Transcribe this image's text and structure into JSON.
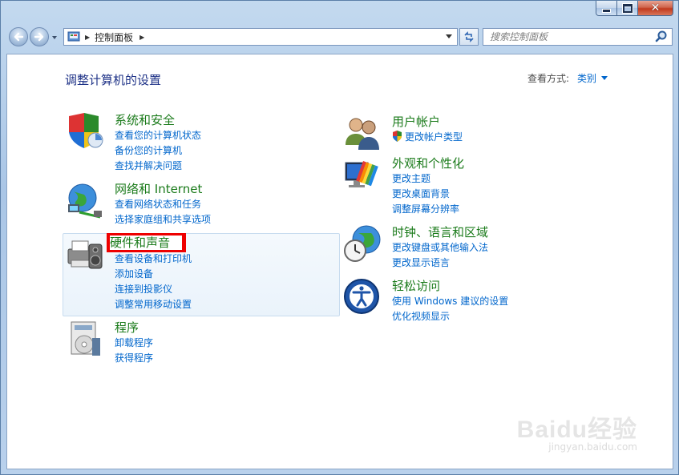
{
  "window": {
    "controls": {
      "minimize": "—",
      "maximize": "□",
      "close": "✕"
    }
  },
  "nav": {
    "breadcrumb": "控制面板",
    "search_placeholder": "搜索控制面板"
  },
  "main": {
    "title": "调整计算机的设置",
    "view_by_label": "查看方式:",
    "view_by_value": "类别"
  },
  "categories": {
    "system_security": {
      "title": "系统和安全",
      "links": [
        "查看您的计算机状态",
        "备份您的计算机",
        "查找并解决问题"
      ]
    },
    "network": {
      "title": "网络和 Internet",
      "links": [
        "查看网络状态和任务",
        "选择家庭组和共享选项"
      ]
    },
    "hardware_sound": {
      "title": "硬件和声音",
      "links": [
        "查看设备和打印机",
        "添加设备",
        "连接到投影仪",
        "调整常用移动设置"
      ]
    },
    "programs": {
      "title": "程序",
      "links": [
        "卸载程序",
        "获得程序"
      ]
    },
    "user_accounts": {
      "title": "用户帐户",
      "links": [
        "更改帐户类型"
      ]
    },
    "appearance": {
      "title": "外观和个性化",
      "links": [
        "更改主题",
        "更改桌面背景",
        "调整屏幕分辨率"
      ]
    },
    "clock_region": {
      "title": "时钟、语言和区域",
      "links": [
        "更改键盘或其他输入法",
        "更改显示语言"
      ]
    },
    "ease_access": {
      "title": "轻松访问",
      "links": [
        "使用 Windows 建议的设置",
        "优化视频显示"
      ]
    }
  },
  "icons": {
    "back": "back-arrow-icon",
    "forward": "forward-arrow-icon",
    "search": "search-icon",
    "refresh": "refresh-icon",
    "control_panel": "control-panel-icon"
  },
  "colors": {
    "link": "#0066cc",
    "category_title": "#1b7b1b",
    "page_title": "#1e3287",
    "highlight_border": "#ee0000"
  },
  "watermark": {
    "brand": "Baidu经验",
    "url": "jingyan.baidu.com"
  }
}
